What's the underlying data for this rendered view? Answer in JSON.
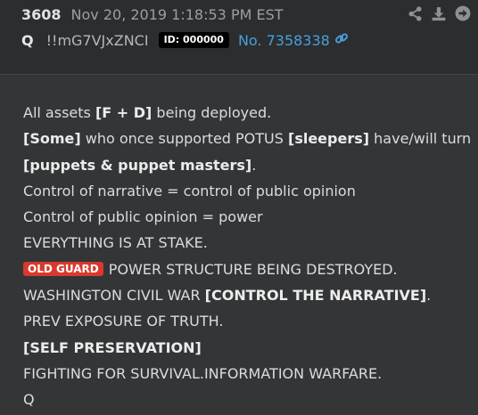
{
  "header": {
    "post_number": "3608",
    "date": "Nov 20, 2019 1:18:53 PM EST",
    "author": "Q",
    "tripcode": "!!mG7VJxZNCI",
    "id_badge": "ID: 000000",
    "post_link": "No. 7358338"
  },
  "body": {
    "l1_a": "All assets ",
    "l1_b": "[F + D]",
    "l1_c": " being deployed.",
    "l2_a": "[Some]",
    "l2_b": " who once supported POTUS ",
    "l2_c": "[sleepers]",
    "l2_d": " have/will turn",
    "l3_a": "[puppets & puppet masters]",
    "l3_b": ".",
    "l4": "Control of narrative = control of public opinion",
    "l5": "Control of public opinion = power",
    "l6": "EVERYTHING IS AT STAKE.",
    "l7_badge": "OLD GUARD",
    "l7_text": " POWER STRUCTURE BEING DESTROYED.",
    "l8_a": "WASHINGTON CIVIL WAR ",
    "l8_b": "[CONTROL THE NARRATIVE]",
    "l8_c": ".",
    "l9": "PREV EXPOSURE OF TRUTH.",
    "l10": "[SELF PRESERVATION]",
    "l11": "FIGHTING FOR SURVIVAL.INFORMATION WARFARE.",
    "l12": "Q"
  },
  "colors": {
    "background": "#333537",
    "header_background": "#2b2d2f",
    "link": "#4a9fdc",
    "badge_red": "#d9392e",
    "id_badge": "#000000"
  },
  "icons": [
    "share-icon",
    "download-icon",
    "arrow-right-circle-icon",
    "link-icon"
  ]
}
